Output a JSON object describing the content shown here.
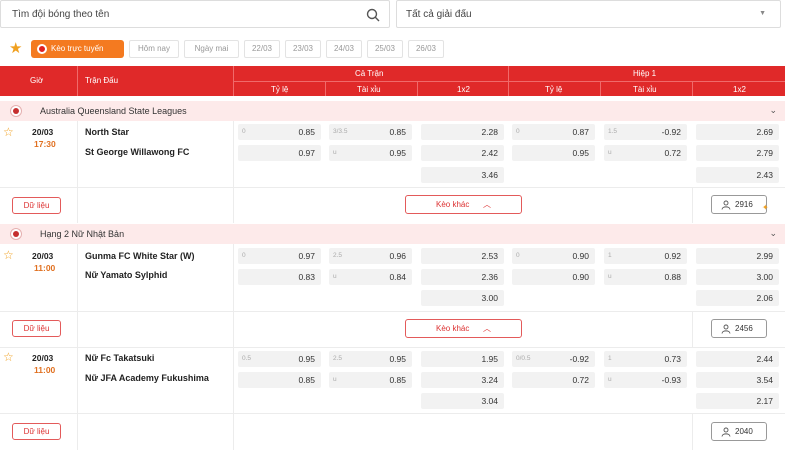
{
  "search": {
    "placeholder": "Tìm đội bóng theo tên"
  },
  "league_select": {
    "value": "Tất cả giải đấu"
  },
  "tabs": {
    "live": "Kèo trực tuyến",
    "today": "Hôm nay",
    "tomorrow": "Ngày mai",
    "dates": [
      "22/03",
      "23/03",
      "24/03",
      "25/03",
      "26/03"
    ]
  },
  "header": {
    "time": "Giờ",
    "match": "Trận Đấu",
    "fulltime": "Cả Trận",
    "half": "Hiệp 1",
    "handicap": "Tỷ lệ",
    "overunder": "Tài xỉu",
    "onextwo": "1x2"
  },
  "leagues": [
    {
      "name": "Australia Queensland State Leagues"
    },
    {
      "name": "Hạng 2 Nữ Nhật Bản"
    }
  ],
  "matches": [
    {
      "date": "20/03",
      "time": "17:30",
      "home": "North Star",
      "away": "St George Willawong FC",
      "ft_hdp": {
        "line": "0",
        "home": "0.85",
        "away": "0.97"
      },
      "ft_ou": {
        "line": "3/3.5",
        "over": "0.85",
        "u": "u",
        "under": "0.95"
      },
      "ft_1x2": {
        "h": "2.28",
        "a": "2.42",
        "d": "3.46"
      },
      "h1_hdp": {
        "line": "0",
        "home": "0.87",
        "away": "0.95"
      },
      "h1_ou": {
        "line": "1.5",
        "over": "-0.92",
        "u": "u",
        "under": "0.72"
      },
      "h1_1x2": {
        "h": "2.69",
        "a": "2.79",
        "d": "2.43"
      },
      "data_label": "Dữ liệu",
      "more_label": "Kèo khác",
      "count": "2916"
    },
    {
      "date": "20/03",
      "time": "11:00",
      "home": "Gunma FC White Star (W)",
      "away": "Nữ Yamato Sylphid",
      "ft_hdp": {
        "line": "0",
        "home": "0.97",
        "away": "0.83"
      },
      "ft_ou": {
        "line": "2.5",
        "over": "0.96",
        "u": "u",
        "under": "0.84"
      },
      "ft_1x2": {
        "h": "2.53",
        "a": "2.36",
        "d": "3.00"
      },
      "h1_hdp": {
        "line": "0",
        "home": "0.90",
        "away": "0.90"
      },
      "h1_ou": {
        "line": "1",
        "over": "0.92",
        "u": "u",
        "under": "0.88"
      },
      "h1_1x2": {
        "h": "2.99",
        "a": "3.00",
        "d": "2.06"
      },
      "data_label": "Dữ liệu",
      "more_label": "Kèo khác",
      "count": "2456"
    },
    {
      "date": "20/03",
      "time": "11:00",
      "home": "Nữ Fc Takatsuki",
      "away": "Nữ JFA Academy Fukushima",
      "ft_hdp": {
        "line": "0.5",
        "home": "0.95",
        "away": "0.85"
      },
      "ft_ou": {
        "line": "2.5",
        "over": "0.95",
        "u": "u",
        "under": "0.85"
      },
      "ft_1x2": {
        "h": "1.95",
        "a": "3.24",
        "d": "3.04"
      },
      "h1_hdp": {
        "line": "0/0.5",
        "home": "-0.92",
        "away": "0.72"
      },
      "h1_ou": {
        "line": "1",
        "over": "0.73",
        "u": "u",
        "under": "-0.93"
      },
      "h1_1x2": {
        "h": "2.44",
        "a": "3.54",
        "d": "2.17"
      },
      "data_label": "Dữ liệu",
      "count": "2040"
    }
  ],
  "colors": {
    "header_red": "#e02929",
    "accent_orange": "#f47a20",
    "league_bg": "#fdeaea",
    "star": "#f0a020"
  }
}
